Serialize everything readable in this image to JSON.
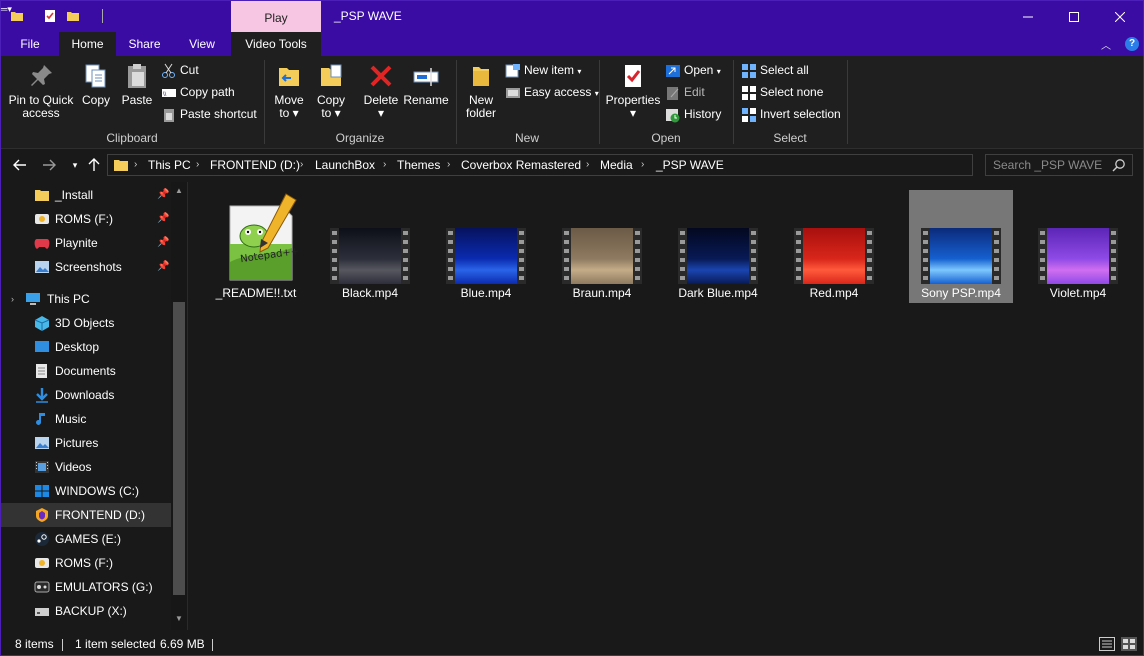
{
  "window": {
    "title": "_PSP WAVE",
    "contextual_tab": "Play"
  },
  "ribbon_tabs": {
    "file": "File",
    "home": "Home",
    "share": "Share",
    "view": "View",
    "video_tools": "Video Tools"
  },
  "ribbon": {
    "clipboard": {
      "label": "Clipboard",
      "pin": [
        "Pin to Quick",
        "access"
      ],
      "copy": "Copy",
      "paste": "Paste",
      "cut": "Cut",
      "copy_path": "Copy path",
      "paste_shortcut": "Paste shortcut"
    },
    "organize": {
      "label": "Organize",
      "move_to": [
        "Move",
        "to ▾"
      ],
      "copy_to": [
        "Copy",
        "to ▾"
      ],
      "delete": [
        "Delete",
        "▾"
      ],
      "rename": "Rename"
    },
    "new": {
      "label": "New",
      "new_folder": [
        "New",
        "folder"
      ],
      "new_item": "New item",
      "easy_access": "Easy access"
    },
    "open": {
      "label": "Open",
      "properties": [
        "Properties",
        "▾"
      ],
      "open": "Open",
      "edit": "Edit",
      "history": "History"
    },
    "select": {
      "label": "Select",
      "select_all": "Select all",
      "select_none": "Select none",
      "invert": "Invert selection"
    }
  },
  "address": {
    "crumbs": [
      "This PC",
      "FRONTEND (D:)",
      "LaunchBox",
      "Themes",
      "Coverbox Remastered",
      "Media",
      "_PSP WAVE"
    ],
    "search_placeholder": "Search _PSP WAVE"
  },
  "nav_pane": {
    "quick_access": [
      {
        "label": "_Install",
        "icon": "folder-icon"
      },
      {
        "label": "ROMS (F:)",
        "icon": "drive-icon"
      },
      {
        "label": "Playnite",
        "icon": "gamepad-icon"
      },
      {
        "label": "Screenshots",
        "icon": "pictures-icon"
      }
    ],
    "this_pc": "This PC",
    "items": [
      {
        "label": "3D Objects",
        "icon": "3d-objects-icon"
      },
      {
        "label": "Desktop",
        "icon": "desktop-icon"
      },
      {
        "label": "Documents",
        "icon": "documents-icon"
      },
      {
        "label": "Downloads",
        "icon": "downloads-icon"
      },
      {
        "label": "Music",
        "icon": "music-icon"
      },
      {
        "label": "Pictures",
        "icon": "pictures-icon"
      },
      {
        "label": "Videos",
        "icon": "videos-icon"
      },
      {
        "label": "WINDOWS (C:)",
        "icon": "windows-drive-icon"
      },
      {
        "label": "FRONTEND (D:)",
        "icon": "launchbox-drive-icon"
      },
      {
        "label": "GAMES (E:)",
        "icon": "steam-drive-icon"
      },
      {
        "label": "ROMS (F:)",
        "icon": "roms-drive-icon"
      },
      {
        "label": "EMULATORS (G:)",
        "icon": "emulators-drive-icon"
      },
      {
        "label": "BACKUP (X:)",
        "icon": "backup-drive-icon"
      }
    ]
  },
  "files": [
    {
      "name": "_README!!.txt",
      "kind": "notepad",
      "colors": [
        "#ffffff"
      ]
    },
    {
      "name": "Black.mp4",
      "kind": "video",
      "colors": [
        "#0d0f18",
        "#2c2e3a",
        "#56575f"
      ]
    },
    {
      "name": "Blue.mp4",
      "kind": "video",
      "colors": [
        "#07125e",
        "#0a2bb0",
        "#2a64e8"
      ]
    },
    {
      "name": "Braun.mp4",
      "kind": "video",
      "colors": [
        "#6b5a46",
        "#8e7a60",
        "#c4ac88"
      ]
    },
    {
      "name": "Dark Blue.mp4",
      "kind": "video",
      "colors": [
        "#03081f",
        "#081a55",
        "#1a45b0"
      ]
    },
    {
      "name": "Red.mp4",
      "kind": "video",
      "colors": [
        "#a8100e",
        "#d9261a",
        "#ff5a3c"
      ]
    },
    {
      "name": "Sony PSP.mp4",
      "kind": "video",
      "colors": [
        "#0b2a7a",
        "#1560d0",
        "#7ec7ff"
      ]
    },
    {
      "name": "Violet.mp4",
      "kind": "video",
      "colors": [
        "#5b25b6",
        "#8f4ae6",
        "#d06ef0"
      ]
    }
  ],
  "selected_file": "Sony PSP.mp4",
  "status": {
    "items": "8 items",
    "selected": "1 item selected",
    "size": "6.69 MB"
  }
}
